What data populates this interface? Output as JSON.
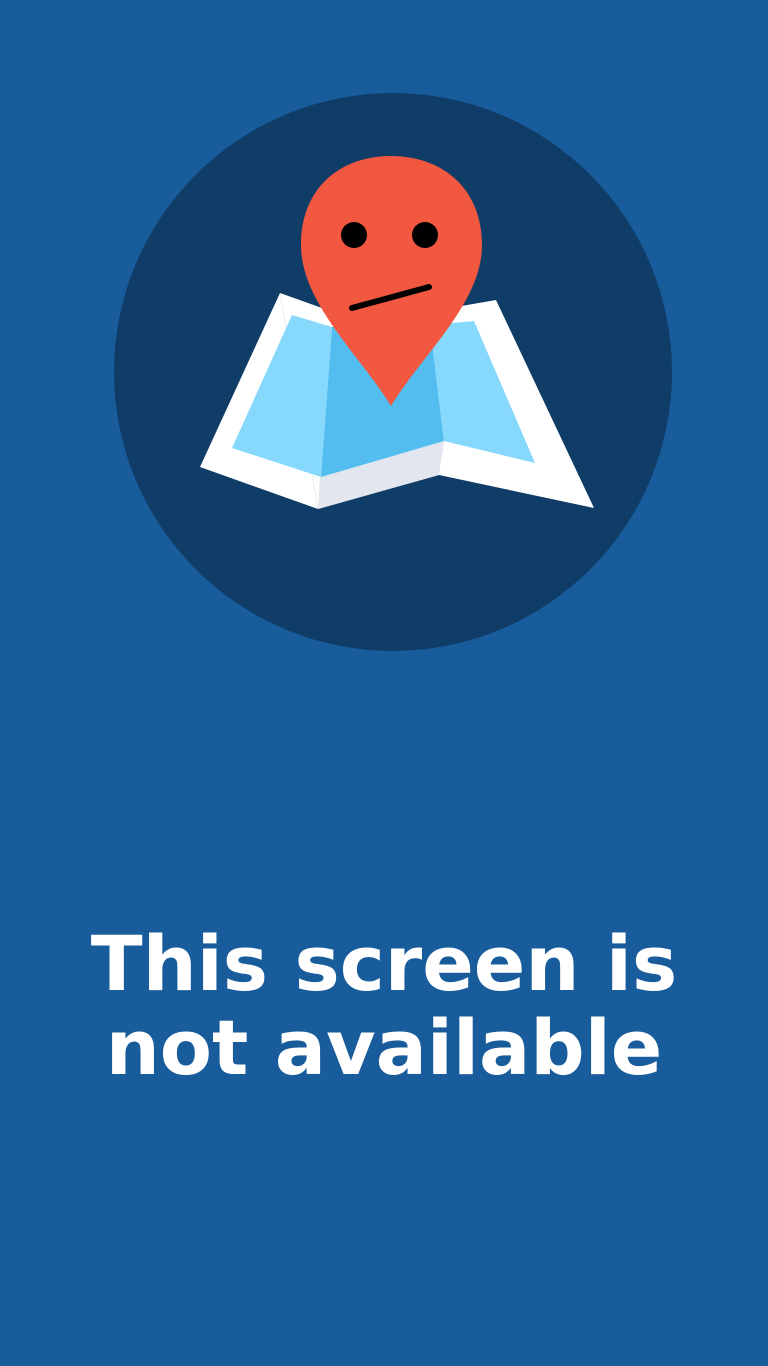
{
  "colors": {
    "background": "#185c9b",
    "circle": "#103d68",
    "pin": "#f25740",
    "map_border": "#ffffff",
    "map_light": "#86d9fc",
    "map_mid": "#54bdf0",
    "map_fold_shadow": "#e2e6ee",
    "message_text": "#ffffff"
  },
  "icons": {
    "illustration": "map-with-sad-pin-icon"
  },
  "message": {
    "line1": "This screen is",
    "line2": "not available"
  }
}
